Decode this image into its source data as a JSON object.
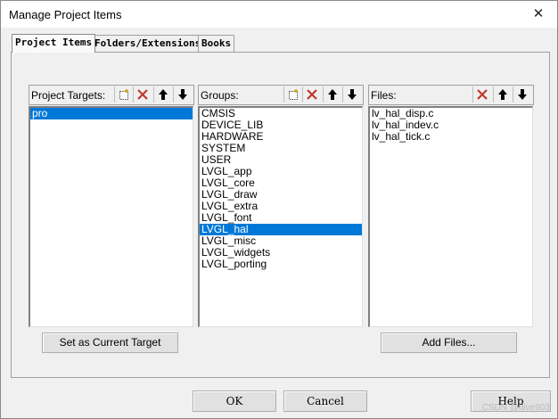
{
  "window": {
    "title": "Manage Project Items"
  },
  "tabs": [
    {
      "label": "Project Items"
    },
    {
      "label": "Folders/Extensions"
    },
    {
      "label": "Books"
    }
  ],
  "targets": {
    "header": "Project Targets:",
    "items": [
      "pro"
    ],
    "selected": "pro",
    "button": "Set as Current Target"
  },
  "groups": {
    "header": "Groups:",
    "items": [
      "CMSIS",
      "DEVICE_LIB",
      "HARDWARE",
      "SYSTEM",
      "USER",
      "LVGL_app",
      "LVGL_core",
      "LVGL_draw",
      "LVGL_extra",
      "LVGL_font",
      "LVGL_hal",
      "LVGL_misc",
      "LVGL_widgets",
      "LVGL_porting"
    ],
    "selected": "LVGL_hal"
  },
  "files": {
    "header": "Files:",
    "items": [
      "lv_hal_disp.c",
      "lv_hal_indev.c",
      "lv_hal_tick.c"
    ],
    "button": "Add Files..."
  },
  "buttons": {
    "ok": "OK",
    "cancel": "Cancel",
    "help": "Help"
  },
  "watermark": "CSDN @dive903",
  "colors": {
    "selection": "#0078d7",
    "delete_red": "#c0392b"
  },
  "icons": {
    "new": "new-item-icon",
    "delete": "delete-icon",
    "up": "move-up-icon",
    "down": "move-down-icon"
  }
}
